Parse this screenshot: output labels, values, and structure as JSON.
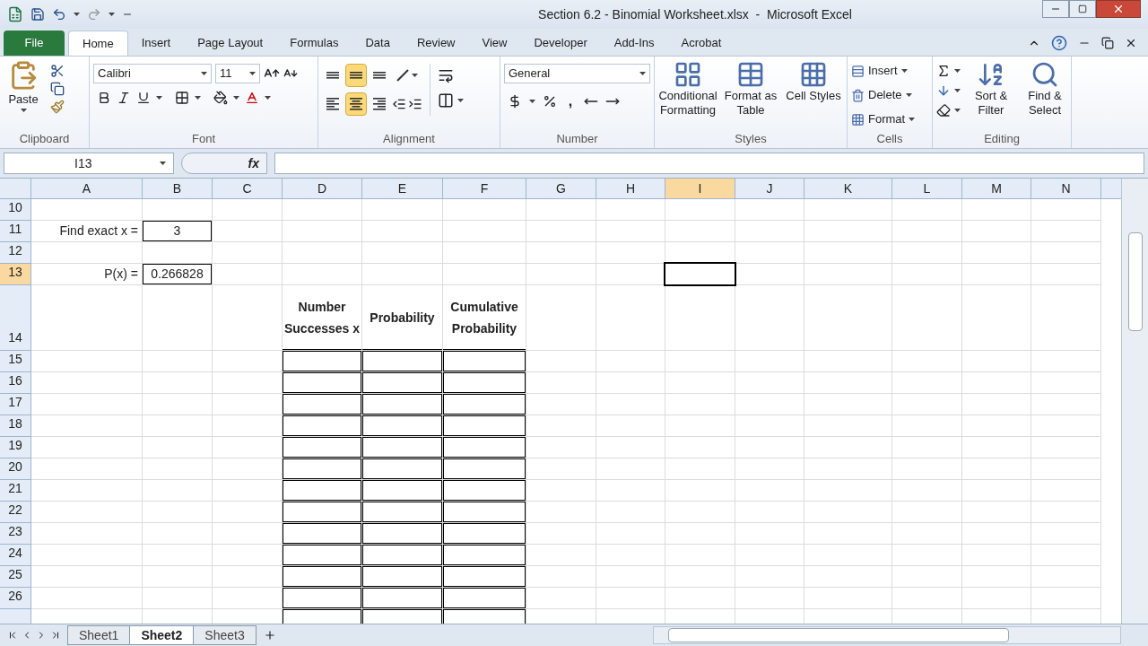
{
  "window": {
    "title": "Section 6.2 - Binomial Worksheet.xlsx  -  Microsoft Excel"
  },
  "file_button": "File",
  "ribbon_tabs": [
    {
      "label": "Home",
      "selected": true
    },
    {
      "label": "Insert",
      "selected": false
    },
    {
      "label": "Page Layout",
      "selected": false
    },
    {
      "label": "Formulas",
      "selected": false
    },
    {
      "label": "Data",
      "selected": false
    },
    {
      "label": "Review",
      "selected": false
    },
    {
      "label": "View",
      "selected": false
    },
    {
      "label": "Developer",
      "selected": false
    },
    {
      "label": "Add-Ins",
      "selected": false
    },
    {
      "label": "Acrobat",
      "selected": false
    }
  ],
  "clipboard": {
    "label": "Clipboard",
    "paste": "Paste"
  },
  "font": {
    "label": "Font",
    "font_name": "Calibri",
    "font_size": "11"
  },
  "alignment": {
    "label": "Alignment",
    "vertical": [
      {
        "selected": false
      },
      {
        "selected": true
      },
      {
        "selected": false
      }
    ],
    "horizontal": [
      {
        "selected": false
      },
      {
        "selected": true
      },
      {
        "selected": false
      }
    ]
  },
  "number": {
    "label": "Number",
    "format": "General",
    "comma_style": ","
  },
  "styles": {
    "label": "Styles",
    "commands": [
      "Conditional Formatting",
      "Format as Table",
      "Cell Styles"
    ]
  },
  "cells": {
    "label": "Cells",
    "commands": [
      "Insert",
      "Delete",
      "Format"
    ]
  },
  "editing": {
    "label": "Editing",
    "commands": [
      "Sort & Filter",
      "Find & Select"
    ]
  },
  "formula_bar": {
    "name_box": "I13",
    "insert_function": "fx"
  },
  "columns": [
    {
      "label": "A",
      "selected": false
    },
    {
      "label": "B",
      "selected": false
    },
    {
      "label": "C",
      "selected": false
    },
    {
      "label": "D",
      "selected": false
    },
    {
      "label": "E",
      "selected": false
    },
    {
      "label": "F",
      "selected": false
    },
    {
      "label": "G",
      "selected": false
    },
    {
      "label": "H",
      "selected": false
    },
    {
      "label": "I",
      "selected": true
    },
    {
      "label": "J",
      "selected": false
    },
    {
      "label": "K",
      "selected": false
    },
    {
      "label": "L",
      "selected": false
    },
    {
      "label": "M",
      "selected": false
    },
    {
      "label": "N",
      "selected": false
    }
  ],
  "rows": [
    {
      "label": "10",
      "kind": "normal",
      "selected": false
    },
    {
      "label": "11",
      "kind": "normal",
      "selected": false,
      "cells": [
        {
          "kind": "label",
          "text": "Find exact x ="
        },
        {
          "kind": "value",
          "text": "3"
        }
      ]
    },
    {
      "label": "12",
      "kind": "normal",
      "selected": false
    },
    {
      "label": "13",
      "kind": "normal",
      "selected": true,
      "cells": [
        {
          "kind": "label",
          "text": "P(x) ="
        },
        {
          "kind": "value",
          "text": "0.266828"
        }
      ]
    },
    {
      "label": "14",
      "kind": "tall",
      "selected": false,
      "cells": [
        {
          "kind": "empty"
        },
        {
          "kind": "empty"
        },
        {
          "kind": "empty"
        },
        {
          "kind": "heading",
          "text": "Number Successes x"
        },
        {
          "kind": "heading",
          "text": "Probability"
        },
        {
          "kind": "heading",
          "text": "Cumulative Probability"
        }
      ]
    },
    {
      "label": "15",
      "kind": "normal",
      "selected": false,
      "cells": [
        {
          "kind": "empty"
        },
        {
          "kind": "empty"
        },
        {
          "kind": "empty"
        },
        {
          "kind": "boxed"
        },
        {
          "kind": "boxed"
        },
        {
          "kind": "boxed"
        }
      ]
    },
    {
      "label": "16",
      "kind": "normal",
      "selected": false,
      "cells": [
        {
          "kind": "empty"
        },
        {
          "kind": "empty"
        },
        {
          "kind": "empty"
        },
        {
          "kind": "boxed"
        },
        {
          "kind": "boxed"
        },
        {
          "kind": "boxed"
        }
      ]
    },
    {
      "label": "17",
      "kind": "normal",
      "selected": false,
      "cells": [
        {
          "kind": "empty"
        },
        {
          "kind": "empty"
        },
        {
          "kind": "empty"
        },
        {
          "kind": "boxed"
        },
        {
          "kind": "boxed"
        },
        {
          "kind": "boxed"
        }
      ]
    },
    {
      "label": "18",
      "kind": "normal",
      "selected": false,
      "cells": [
        {
          "kind": "empty"
        },
        {
          "kind": "empty"
        },
        {
          "kind": "empty"
        },
        {
          "kind": "boxed"
        },
        {
          "kind": "boxed"
        },
        {
          "kind": "boxed"
        }
      ]
    },
    {
      "label": "19",
      "kind": "normal",
      "selected": false,
      "cells": [
        {
          "kind": "empty"
        },
        {
          "kind": "empty"
        },
        {
          "kind": "empty"
        },
        {
          "kind": "boxed"
        },
        {
          "kind": "boxed"
        },
        {
          "kind": "boxed"
        }
      ]
    },
    {
      "label": "20",
      "kind": "normal",
      "selected": false,
      "cells": [
        {
          "kind": "empty"
        },
        {
          "kind": "empty"
        },
        {
          "kind": "empty"
        },
        {
          "kind": "boxed"
        },
        {
          "kind": "boxed"
        },
        {
          "kind": "boxed"
        }
      ]
    },
    {
      "label": "21",
      "kind": "normal",
      "selected": false,
      "cells": [
        {
          "kind": "empty"
        },
        {
          "kind": "empty"
        },
        {
          "kind": "empty"
        },
        {
          "kind": "boxed"
        },
        {
          "kind": "boxed"
        },
        {
          "kind": "boxed"
        }
      ]
    },
    {
      "label": "22",
      "kind": "normal",
      "selected": false,
      "cells": [
        {
          "kind": "empty"
        },
        {
          "kind": "empty"
        },
        {
          "kind": "empty"
        },
        {
          "kind": "boxed"
        },
        {
          "kind": "boxed"
        },
        {
          "kind": "boxed"
        }
      ]
    },
    {
      "label": "23",
      "kind": "normal",
      "selected": false,
      "cells": [
        {
          "kind": "empty"
        },
        {
          "kind": "empty"
        },
        {
          "kind": "empty"
        },
        {
          "kind": "boxed"
        },
        {
          "kind": "boxed"
        },
        {
          "kind": "boxed"
        }
      ]
    },
    {
      "label": "24",
      "kind": "normal",
      "selected": false,
      "cells": [
        {
          "kind": "empty"
        },
        {
          "kind": "empty"
        },
        {
          "kind": "empty"
        },
        {
          "kind": "boxed"
        },
        {
          "kind": "boxed"
        },
        {
          "kind": "boxed"
        }
      ]
    },
    {
      "label": "25",
      "kind": "normal",
      "selected": false,
      "cells": [
        {
          "kind": "empty"
        },
        {
          "kind": "empty"
        },
        {
          "kind": "empty"
        },
        {
          "kind": "boxed"
        },
        {
          "kind": "boxed"
        },
        {
          "kind": "boxed"
        }
      ]
    },
    {
      "label": "26",
      "kind": "normal",
      "selected": false,
      "cells": [
        {
          "kind": "empty"
        },
        {
          "kind": "empty"
        },
        {
          "kind": "empty"
        },
        {
          "kind": "boxed"
        },
        {
          "kind": "boxed"
        },
        {
          "kind": "boxed"
        }
      ]
    },
    {
      "kind": "normal",
      "selected": false,
      "cells": [
        {
          "kind": "empty"
        },
        {
          "kind": "empty"
        },
        {
          "kind": "empty"
        },
        {
          "kind": "boxed"
        },
        {
          "kind": "boxed"
        },
        {
          "kind": "boxed"
        }
      ]
    }
  ],
  "sheet_tabs": [
    {
      "label": "Sheet1",
      "selected": false
    },
    {
      "label": "Sheet2",
      "selected": true
    },
    {
      "label": "Sheet3",
      "selected": false
    }
  ]
}
